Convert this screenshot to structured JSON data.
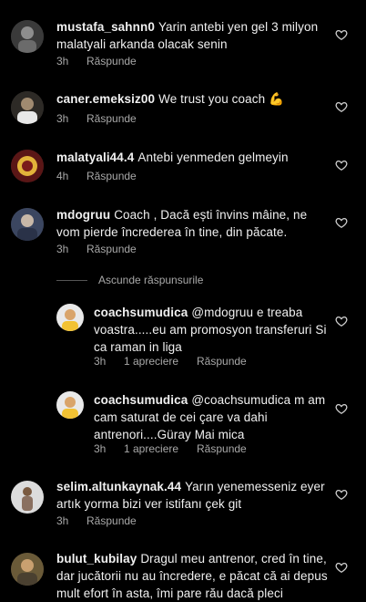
{
  "comments": [
    {
      "user": "mustafa_sahnn0",
      "text": "Yarin antebi yen gel 3 milyon malatyali arkanda olacak senin",
      "time": "3h",
      "reply": "Răspunde"
    },
    {
      "user": "caner.emeksiz00",
      "text": "We trust you coach 💪",
      "time": "3h",
      "reply": "Răspunde"
    },
    {
      "user": "malatyali44.4",
      "text": "Antebi yenmeden gelmeyin",
      "time": "4h",
      "reply": "Răspunde"
    },
    {
      "user": "mdogruu",
      "text": "Coach , Dacă ești învins mâine, ne vom pierde încrederea în tine, din păcate.",
      "time": "3h",
      "reply": "Răspunde"
    },
    {
      "user": "coachsumudica",
      "text": "@mdogruu e treaba voastra.....eu am promosyon transferuri Si ca raman in liga",
      "time": "3h",
      "likes": "1 apreciere",
      "reply": "Răspunde"
    },
    {
      "user": "coachsumudica",
      "text": "@coachsumudica m am cam saturat de cei çare va dahi antrenori....Güray Mai mica",
      "time": "3h",
      "likes": "1 apreciere",
      "reply": "Răspunde"
    },
    {
      "user": "selim.altunkaynak.44",
      "text": "Yarın yenemesseniz eyer artık yorma bizi ver istifanı çek git",
      "time": "3h",
      "reply": "Răspunde"
    },
    {
      "user": "bulut_kubilay",
      "text": "Dragul meu antrenor, cred în tine, dar jucătorii nu au încredere, e păcat că ai depus mult efort în asta, îmi pare rău dacă pleci",
      "time": "",
      "reply": ""
    }
  ],
  "hide_replies": "Ascunde răspunsurile",
  "icons": {
    "like": "heart-outline-icon"
  },
  "colors": {
    "background": "#000000",
    "meta": "#a8a8a8"
  }
}
